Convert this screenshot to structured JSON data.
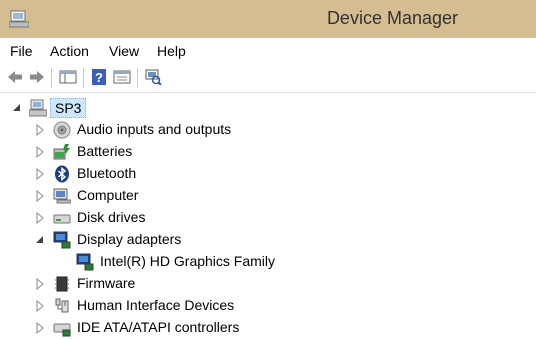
{
  "window": {
    "title": "Device Manager"
  },
  "menu": [
    "File",
    "Action",
    "View",
    "Help"
  ],
  "toolbar": {
    "buttons": [
      "back-icon",
      "forward-icon",
      "console-tree-icon",
      "help-icon",
      "properties-icon",
      "scan-hardware-icon"
    ]
  },
  "tree": {
    "root": "SP3",
    "items": [
      {
        "label": "Audio inputs and outputs",
        "icon": "speaker-icon",
        "expanded": false
      },
      {
        "label": "Batteries",
        "icon": "battery-icon",
        "expanded": false
      },
      {
        "label": "Bluetooth",
        "icon": "bluetooth-icon",
        "expanded": false
      },
      {
        "label": "Computer",
        "icon": "computer-icon",
        "expanded": false
      },
      {
        "label": "Disk drives",
        "icon": "disk-icon",
        "expanded": false
      },
      {
        "label": "Display adapters",
        "icon": "display-adapter-icon",
        "expanded": true,
        "children": [
          {
            "label": "Intel(R) HD Graphics Family",
            "icon": "display-adapter-icon"
          }
        ]
      },
      {
        "label": "Firmware",
        "icon": "firmware-icon",
        "expanded": false
      },
      {
        "label": "Human Interface Devices",
        "icon": "hid-icon",
        "expanded": false
      },
      {
        "label": "IDE ATA/ATAPI controllers",
        "icon": "ide-controller-icon",
        "expanded": false
      }
    ]
  },
  "colors": {
    "titlebar": "#d4bd91",
    "selection": "#cce8ff"
  }
}
